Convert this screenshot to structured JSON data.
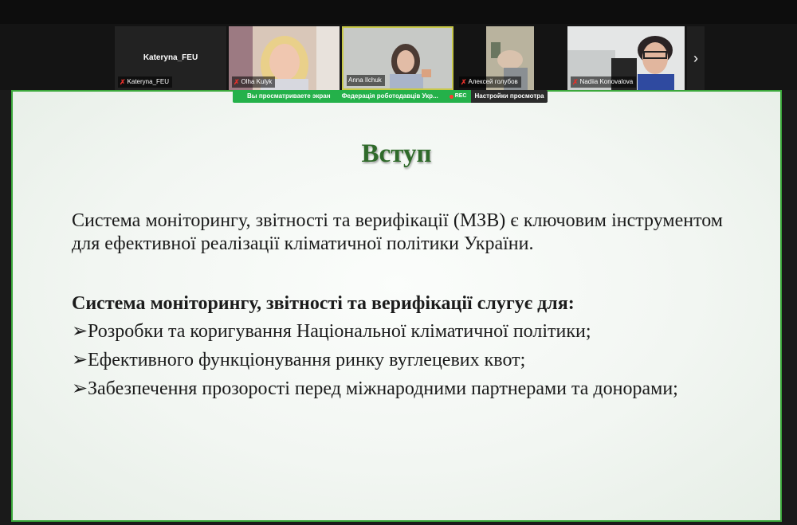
{
  "participants": [
    {
      "name": "Kateryna_FEU",
      "center_label": "Kateryna_FEU",
      "muted": true
    },
    {
      "name": "Olha Kulyk",
      "muted": true
    },
    {
      "name": "Anna Ilchuk",
      "muted": false
    },
    {
      "name": "Алексей голубов",
      "muted": true
    },
    {
      "name": "Nadiia Konovalova",
      "muted": true
    }
  ],
  "share_banner": {
    "viewing_text": "Вы просматриваете экран",
    "presenter": "Федерація роботодавців Укр...",
    "rec_label": "REC",
    "view_options": "Настройки просмотра"
  },
  "slide": {
    "title": "Вступ",
    "paragraph": "Система моніторингу, звітності та верифікації (МЗВ) є ключовим інструментом для ефективної реалізації кліматичної політики України.",
    "subheading": "Система моніторингу, звітності та верифікації слугує для:",
    "bullet_marker": "➢",
    "bullets": [
      "Розробки та коригування Національної кліматичної політики;",
      "Ефективного функціонування ринку вуглецевих квот;",
      "Забезпечення прозорості перед міжнародними партнерами та донорами;"
    ]
  },
  "colors": {
    "accent_green": "#24b14a",
    "slide_border": "#3ba83b",
    "title_green": "#2f6a2a",
    "mute_red": "#e0312b"
  }
}
